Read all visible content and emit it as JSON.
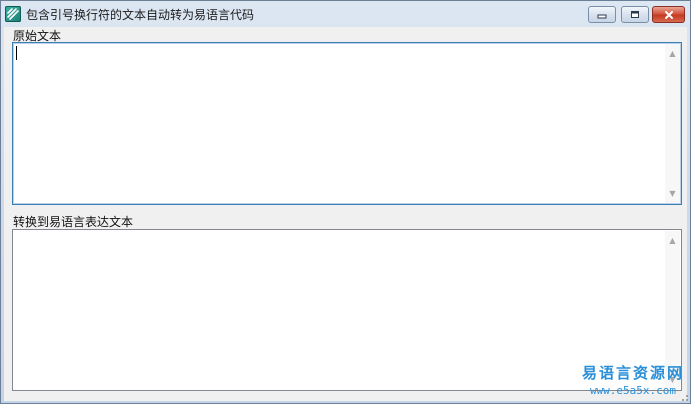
{
  "window": {
    "title": "包含引号换行符的文本自动转为易语言代码",
    "controls": {
      "minimize_icon": "minimize-icon",
      "maximize_icon": "maximize-icon",
      "close_icon": "close-icon"
    }
  },
  "original_text": {
    "label": "原始文本",
    "value": ""
  },
  "converted_text": {
    "label": "转换到易语言表达文本",
    "value": ""
  },
  "watermark": {
    "title": "易语言资源网",
    "url": "www.e5a5x.com"
  },
  "colors": {
    "watermark": "#2a8fd8",
    "close_button": "#c43b22",
    "focus_border": "#3c7fb1"
  }
}
